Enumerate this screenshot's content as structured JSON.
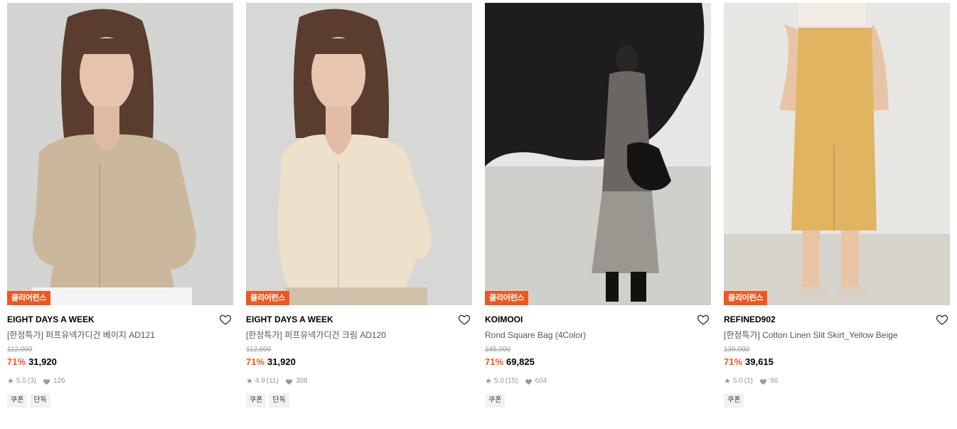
{
  "products": [
    {
      "badge": "클리어런스",
      "brand": "EIGHT DAYS A WEEK",
      "name": "[한정특가] 퍼프유넥가디건 베이지 AD121",
      "original_price": "112,000",
      "discount": "71%",
      "price": "31,920",
      "rating": "5.0",
      "reviews": "(3)",
      "likes": "126",
      "tags": [
        "쿠폰",
        "단독"
      ],
      "image": "woman-beige-knit-cardigan-photo"
    },
    {
      "badge": "클리어런스",
      "brand": "EIGHT DAYS A WEEK",
      "name": "[한정특가] 퍼프유넥가디건 크림 AD120",
      "original_price": "112,000",
      "discount": "71%",
      "price": "31,920",
      "rating": "4.9",
      "reviews": "(11)",
      "likes": "308",
      "tags": [
        "쿠폰",
        "단독"
      ],
      "image": "woman-cream-knit-cardigan-photo"
    },
    {
      "badge": "클리어런스",
      "brand": "KOIMOOI",
      "name": "Rond Square Bag (4Color)",
      "original_price": "245,000",
      "discount": "71%",
      "price": "69,825",
      "rating": "5.0",
      "reviews": "(15)",
      "likes": "604",
      "tags": [
        "쿠폰"
      ],
      "image": "woman-with-black-bag-near-rock-photo"
    },
    {
      "badge": "클리어런스",
      "brand": "REFINED902",
      "name": "[한정특가] Cotton Linen Slit Skirt_Yellow Beige",
      "original_price": "139,000",
      "discount": "71%",
      "price": "39,615",
      "rating": "5.0",
      "reviews": "(1)",
      "likes": "96",
      "tags": [
        "쿠폰"
      ],
      "image": "yellow-beige-midi-skirt-photo"
    }
  ],
  "colors": {
    "accent": "#f0571f",
    "muted": "#999999",
    "tag_bg": "#f2f2f2"
  }
}
